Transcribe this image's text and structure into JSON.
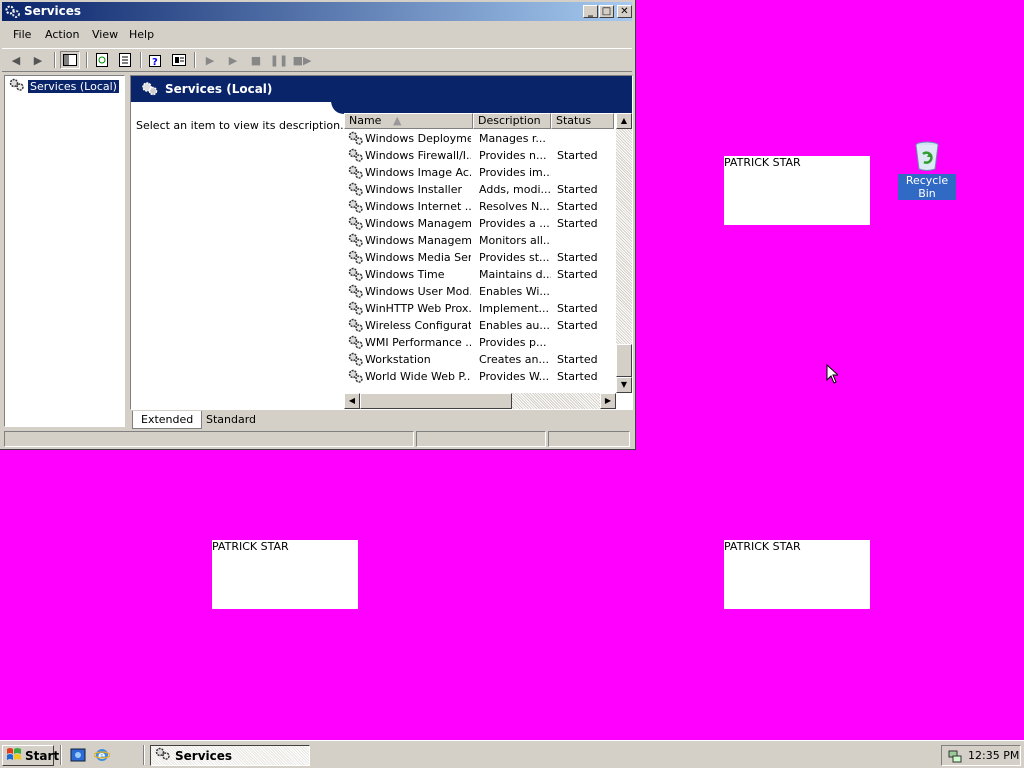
{
  "desktop": {
    "background": "#ff00ff",
    "notes": [
      "PATRICK STAR",
      "PATRICK STAR",
      "PATRICK STAR"
    ],
    "recycle_bin_label": "Recycle Bin"
  },
  "window": {
    "title": "Services",
    "menu": [
      "File",
      "Action",
      "View",
      "Help"
    ],
    "tree_item": "Services (Local)",
    "pane_title": "Services (Local)",
    "description_hint": "Select an item to view its description.",
    "columns": [
      "Name",
      "Description",
      "Status"
    ],
    "services": [
      {
        "name": "Windows Deployme...",
        "description": "Manages r...",
        "status": ""
      },
      {
        "name": "Windows Firewall/I...",
        "description": "Provides n...",
        "status": "Started"
      },
      {
        "name": "Windows Image Ac...",
        "description": "Provides im...",
        "status": ""
      },
      {
        "name": "Windows Installer",
        "description": "Adds, modi...",
        "status": "Started"
      },
      {
        "name": "Windows Internet ...",
        "description": "Resolves N...",
        "status": "Started"
      },
      {
        "name": "Windows Managem...",
        "description": "Provides a ...",
        "status": "Started"
      },
      {
        "name": "Windows Managem...",
        "description": "Monitors all...",
        "status": ""
      },
      {
        "name": "Windows Media Ser...",
        "description": "Provides st...",
        "status": "Started"
      },
      {
        "name": "Windows Time",
        "description": "Maintains d...",
        "status": "Started"
      },
      {
        "name": "Windows User Mod...",
        "description": "Enables Wi...",
        "status": ""
      },
      {
        "name": "WinHTTP Web Prox...",
        "description": "Implement...",
        "status": "Started"
      },
      {
        "name": "Wireless Configurat...",
        "description": "Enables au...",
        "status": "Started"
      },
      {
        "name": "WMI Performance ...",
        "description": "Provides p...",
        "status": ""
      },
      {
        "name": "Workstation",
        "description": "Creates an...",
        "status": "Started"
      },
      {
        "name": "World Wide Web P...",
        "description": "Provides W...",
        "status": "Started"
      }
    ],
    "tabs": [
      "Extended",
      "Standard"
    ],
    "active_tab": "Extended"
  },
  "taskbar": {
    "start_label": "Start",
    "task_label": "Services",
    "clock": "12:35 PM"
  }
}
